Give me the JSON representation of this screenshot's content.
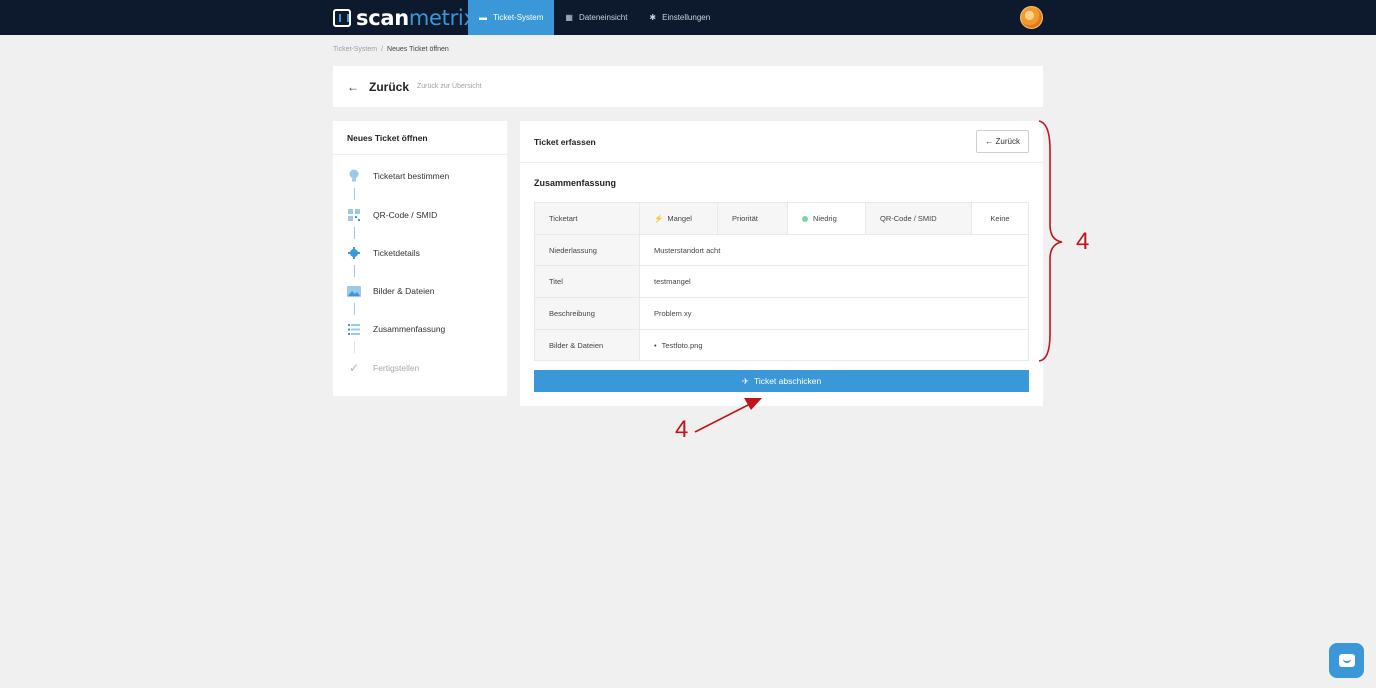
{
  "brand": {
    "name_a": "scan",
    "name_b": "metrix"
  },
  "nav": {
    "items": [
      {
        "label": "Ticket-System",
        "icon": "tickets-icon",
        "active": true
      },
      {
        "label": "Dateneinsicht",
        "icon": "data-icon",
        "active": false
      },
      {
        "label": "Einstellungen",
        "icon": "gear-icon",
        "active": false
      }
    ]
  },
  "breadcrumb": {
    "root": "Ticket-System",
    "sep": "/",
    "current": "Neues Ticket öffnen"
  },
  "header": {
    "back_label": "Zurück",
    "back_sub": "Zurück zur Übersicht"
  },
  "steps": {
    "title": "Neues Ticket öffnen",
    "items": [
      {
        "label": "Ticketart bestimmen",
        "icon": "lightbulb-icon"
      },
      {
        "label": "QR-Code / SMID",
        "icon": "qr-code-icon"
      },
      {
        "label": "Ticketdetails",
        "icon": "gear-icon"
      },
      {
        "label": "Bilder & Dateien",
        "icon": "image-icon"
      },
      {
        "label": "Zusammenfassung",
        "icon": "list-icon"
      },
      {
        "label": "Fertigstellen",
        "icon": "check-icon"
      }
    ]
  },
  "main": {
    "title": "Ticket erfassen",
    "back_button": "Zurück",
    "section_title": "Zusammenfassung",
    "summary": {
      "ticketart_label": "Ticketart",
      "ticketart_value": "Mangel",
      "prioritaet_label": "Priorität",
      "prioritaet_value": "Niedrig",
      "qr_label": "QR-Code / SMID",
      "qr_value": "Keine",
      "niederlassung_label": "Niederlassung",
      "niederlassung_value": "Musterstandort acht",
      "titel_label": "Titel",
      "titel_value": "testmangel",
      "beschreibung_label": "Beschreibung",
      "beschreibung_value": "Problem xy",
      "bilder_label": "Bilder & Dateien",
      "bilder_value": "Testfoto.png"
    },
    "submit_label": "Ticket abschicken"
  },
  "annotations": {
    "brace_number": "4",
    "arrow_number": "4",
    "color": "#c0151b"
  },
  "colors": {
    "accent": "#3a98d8",
    "topbar": "#0d1a2e",
    "background": "#f0f0f1"
  }
}
